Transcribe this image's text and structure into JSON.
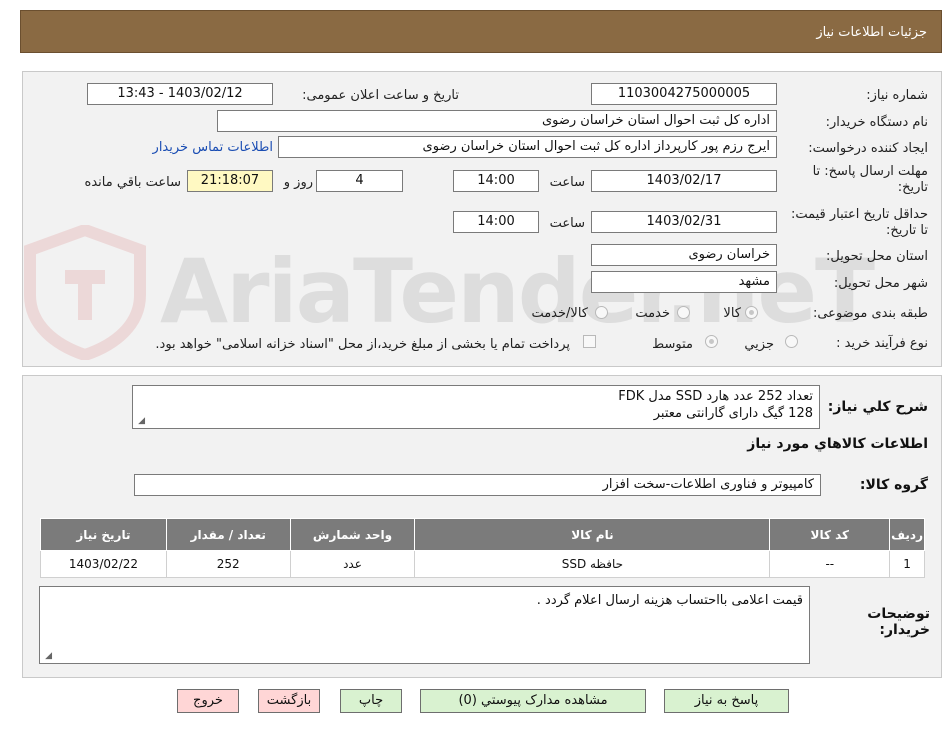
{
  "header": {
    "title": "جزئیات اطلاعات نیاز"
  },
  "form": {
    "need_number_label": "شماره نیاز:",
    "need_number": "1103004275000005",
    "announce_label": "تاریخ و ساعت اعلان عمومی:",
    "announce_value": "1403/02/12 - 13:43",
    "buyer_org_label": "نام دستگاه خریدار:",
    "buyer_org": "اداره کل ثبت احوال استان خراسان رضوی",
    "requester_label": "ایجاد کننده درخواست:",
    "requester": "ایرج رزم پور کارپرداز اداره کل ثبت احوال استان خراسان رضوی",
    "contact_link": "اطلاعات تماس خریدار",
    "deadline_label": "مهلت ارسال پاسخ: تا تاریخ:",
    "deadline_date": "1403/02/17",
    "time_label": "ساعت",
    "deadline_time": "14:00",
    "days_value": "4",
    "days_label": "روز و",
    "remaining_value": "21:18:07",
    "remaining_label": "ساعت باقي مانده",
    "validity_label": "حداقل تاریخ اعتبار قیمت: تا تاریخ:",
    "validity_date": "1403/02/31",
    "validity_time": "14:00",
    "province_label": "استان محل تحویل:",
    "province": "خراسان رضوی",
    "city_label": "شهر محل تحویل:",
    "city": "مشهد",
    "category_label": "طبقه بندی موضوعی:",
    "category_options": [
      "کالا",
      "خدمت",
      "کالا/خدمت"
    ],
    "purchase_type_label": "نوع فرآیند خرید :",
    "purchase_options": [
      "جزیي",
      "متوسط"
    ],
    "payment_note": "پرداخت تمام یا بخشی از مبلغ خرید،از محل \"اسناد خزانه اسلامی\" خواهد بود."
  },
  "summary": {
    "desc_label": "شرح کلي نياز:",
    "desc_line1": "تعداد 252 عدد هارد SSD مدل FDK",
    "desc_line2": "128 گیگ دارای گارانتی معتبر",
    "goods_title": "اطلاعات کالاهاي مورد نياز",
    "group_label": "گروه کالا:",
    "group_value": "کامپیوتر و فناوری اطلاعات-سخت افزار",
    "table": {
      "headers": [
        "رديف",
        "کد کالا",
        "نام کالا",
        "واحد شمارش",
        "تعداد / مقدار",
        "تاریخ نیاز"
      ],
      "rows": [
        [
          "1",
          "--",
          "حافظه SSD",
          "عدد",
          "252",
          "1403/02/22"
        ]
      ]
    },
    "notes_label": "توضیحات خریدار:",
    "notes_value": "قیمت اعلامی بااحتساب هزینه ارسال اعلام گردد ."
  },
  "buttons": {
    "reply": "پاسخ به نیاز",
    "attachments": "مشاهده مدارک پیوستي (0)",
    "print": "چاپ",
    "back": "بازگشت",
    "exit": "خروج"
  },
  "watermark": {
    "text": "AriaTender.neT"
  },
  "colors": {
    "header": "#8a6a43",
    "green_button": "#d9f2d0",
    "pink_button": "#ffd6d6",
    "timer": "#fff9c2"
  }
}
